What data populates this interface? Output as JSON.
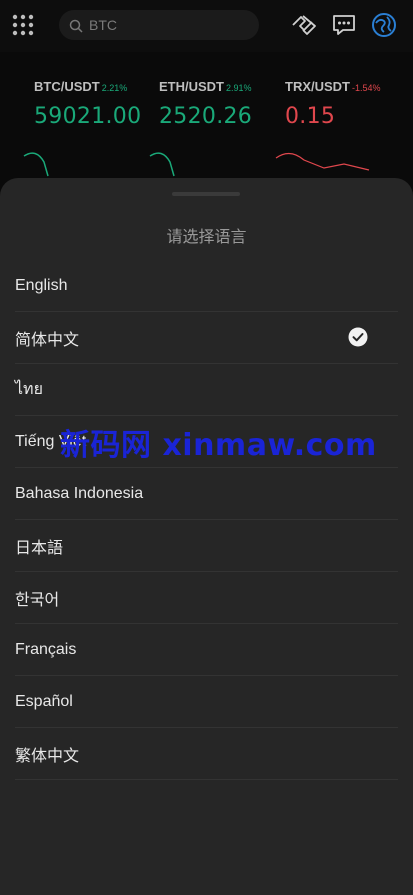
{
  "search": {
    "placeholder": "BTC"
  },
  "tickers": [
    {
      "pair": "BTC/USDT",
      "change": "2.21%",
      "price": "59021.00",
      "trend": "up"
    },
    {
      "pair": "ETH/USDT",
      "change": "2.91%",
      "price": "2520.26",
      "trend": "up"
    },
    {
      "pair": "TRX/USDT",
      "change": "-1.54%",
      "price": "0.15",
      "trend": "down"
    }
  ],
  "sheet": {
    "title": "请选择语言",
    "selected_index": 1,
    "languages": [
      {
        "label": "English"
      },
      {
        "label": "简体中文"
      },
      {
        "label": "ไทย"
      },
      {
        "label": "Tiếng Việt"
      },
      {
        "label": "Bahasa Indonesia"
      },
      {
        "label": "日本語"
      },
      {
        "label": "한국어"
      },
      {
        "label": "Français"
      },
      {
        "label": "Español"
      },
      {
        "label": "繁体中文"
      }
    ]
  },
  "watermark": {
    "text": "新码网 xinmaw.com"
  },
  "colors": {
    "up": "#1aa979",
    "down": "#e0474d",
    "accent": "#2a7fd4",
    "watermark": "#1a24d6"
  },
  "icons": [
    "apps-grid-icon",
    "search-icon",
    "handshake-icon",
    "message-icon",
    "globe-icon",
    "checkmark-icon"
  ]
}
